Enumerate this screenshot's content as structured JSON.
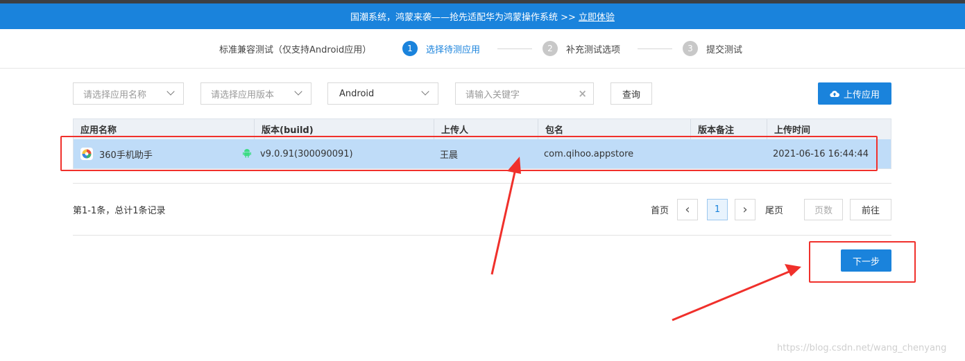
{
  "banner": {
    "text": "国潮系统，鸿蒙来袭——抢先适配华为鸿蒙操作系统 >>",
    "link": "立即体验",
    "color": "#1a83dc"
  },
  "steps": {
    "mode": "标准兼容测试（仅支持Android应用）",
    "items": [
      {
        "num": "1",
        "label": "选择待测应用",
        "active": true
      },
      {
        "num": "2",
        "label": "补充测试选项",
        "active": false
      },
      {
        "num": "3",
        "label": "提交测试",
        "active": false
      }
    ]
  },
  "filters": {
    "app_name_placeholder": "请选择应用名称",
    "app_version_placeholder": "请选择应用版本",
    "platform_value": "Android",
    "keyword_placeholder": "请输入关键字",
    "clear_glyph": "×",
    "query_label": "查询",
    "upload_label": "上传应用"
  },
  "table": {
    "headers": [
      "应用名称",
      "版本(build)",
      "上传人",
      "包名",
      "版本备注",
      "上传时间"
    ],
    "rows": [
      {
        "app_name": "360手机助手",
        "version": "v9.0.91(300090091)",
        "uploader": "王晨",
        "package": "com.qihoo.appstore",
        "note": "",
        "upload_time": "2021-06-16 16:44:44"
      }
    ]
  },
  "pagination": {
    "records": "第1-1条，总计1条记录",
    "first": "首页",
    "prev_glyph": "‹",
    "current": "1",
    "next_glyph": "›",
    "last": "尾页",
    "page_input_placeholder": "页数",
    "go": "前往"
  },
  "next_button": "下一步",
  "annotation_color": "#f0302b",
  "watermark": "https://blog.csdn.net/wang_chenyang"
}
